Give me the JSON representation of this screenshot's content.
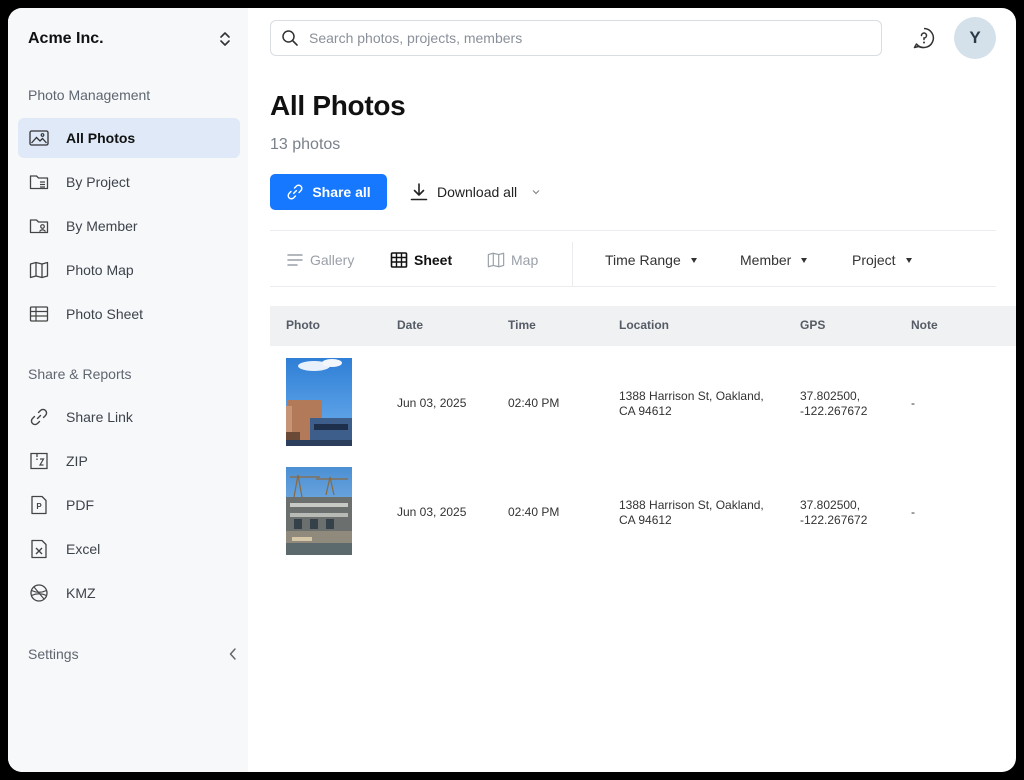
{
  "sidebar": {
    "org_name": "Acme Inc.",
    "section_photo": "Photo Management",
    "photo_items": [
      {
        "label": "All Photos",
        "icon": "image-icon",
        "active": true
      },
      {
        "label": "By Project",
        "icon": "folder-list-icon"
      },
      {
        "label": "By Member",
        "icon": "folder-user-icon"
      },
      {
        "label": "Photo Map",
        "icon": "map-icon"
      },
      {
        "label": "Photo Sheet",
        "icon": "table-icon"
      }
    ],
    "section_share": "Share & Reports",
    "share_items": [
      {
        "label": "Share Link",
        "icon": "link-icon"
      },
      {
        "label": "ZIP",
        "icon": "zip-file-icon"
      },
      {
        "label": "PDF",
        "icon": "pdf-file-icon"
      },
      {
        "label": "Excel",
        "icon": "excel-file-icon"
      },
      {
        "label": "KMZ",
        "icon": "globe-icon"
      }
    ],
    "settings_label": "Settings"
  },
  "header": {
    "search_placeholder": "Search photos, projects, members",
    "avatar_initial": "Y"
  },
  "main": {
    "title": "All Photos",
    "count": "13 photos",
    "share_all": "Share all",
    "download_all": "Download all",
    "views": [
      {
        "label": "Gallery",
        "icon": "list-icon"
      },
      {
        "label": "Sheet",
        "icon": "grid-icon",
        "active": true
      },
      {
        "label": "Map",
        "icon": "map-icon"
      }
    ],
    "filters": [
      "Time Range",
      "Member",
      "Project"
    ]
  },
  "table": {
    "columns": [
      "Photo",
      "Date",
      "Time",
      "Location",
      "GPS",
      "Note"
    ],
    "rows": [
      {
        "date": "Jun 03, 2025",
        "time": "02:40 PM",
        "location_line1": "1388 Harrison St, Oakland,",
        "location_line2": "CA 94612",
        "gps_line1": "37.802500,",
        "gps_line2": "-122.267672",
        "note": "-"
      },
      {
        "date": "Jun 03, 2025",
        "time": "02:40 PM",
        "location_line1": "1388 Harrison St, Oakland,",
        "location_line2": "CA 94612",
        "gps_line1": "37.802500,",
        "gps_line2": "-122.267672",
        "note": "-"
      }
    ]
  },
  "colors": {
    "accent": "#1677ff",
    "active_nav_bg": "#dfe9f7",
    "sidebar_bg": "#f7f8fa"
  }
}
